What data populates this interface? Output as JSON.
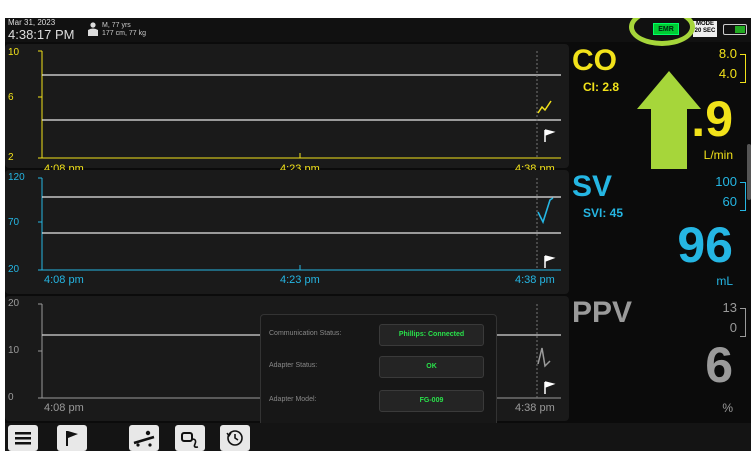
{
  "header": {
    "date": "Mar 31, 2023",
    "time": "4:38:17 PM",
    "patient_line1": "M, 77 yrs",
    "patient_line2": "177 cm, 77 kg",
    "emr_label": "EMR",
    "mode_line1": "MODE",
    "mode_line2": "20 SEC"
  },
  "panels": [
    {
      "param": "CO",
      "color": "#f2e21a",
      "sub": "CI: 2.8",
      "limit_high": "8.0",
      "limit_low": "4.0",
      "value": ".9",
      "unit": "L/min",
      "y_ticks": [
        "10",
        "6",
        "2"
      ],
      "x_ticks": [
        "4:08 pm",
        "4:23 pm",
        "4:38 pm"
      ]
    },
    {
      "param": "SV",
      "color": "#25b6e3",
      "sub": "SVI: 45",
      "limit_high": "100",
      "limit_low": "60",
      "value": "96",
      "unit": "mL",
      "y_ticks": [
        "120",
        "70",
        "20"
      ],
      "x_ticks": [
        "4:08 pm",
        "4:23 pm",
        "4:38 pm"
      ]
    },
    {
      "param": "PPV",
      "color": "#9a9a9a",
      "sub": "",
      "limit_high": "13",
      "limit_low": "0",
      "value": "6",
      "unit": "%",
      "y_ticks": [
        "20",
        "10",
        "0"
      ],
      "x_ticks": [
        "4:08 pm",
        "",
        "4:38 pm"
      ]
    }
  ],
  "popup": {
    "rows": [
      {
        "label": "Communication Status:",
        "value": "Phillips: Connected"
      },
      {
        "label": "Adapter Status:",
        "value": "OK"
      },
      {
        "label": "Adapter Model:",
        "value": "FG-009"
      }
    ]
  },
  "toolbar": {
    "icons": [
      "menu-icon",
      "flag-icon",
      "patient-bed-icon",
      "sensor-icon",
      "history-icon"
    ]
  }
}
